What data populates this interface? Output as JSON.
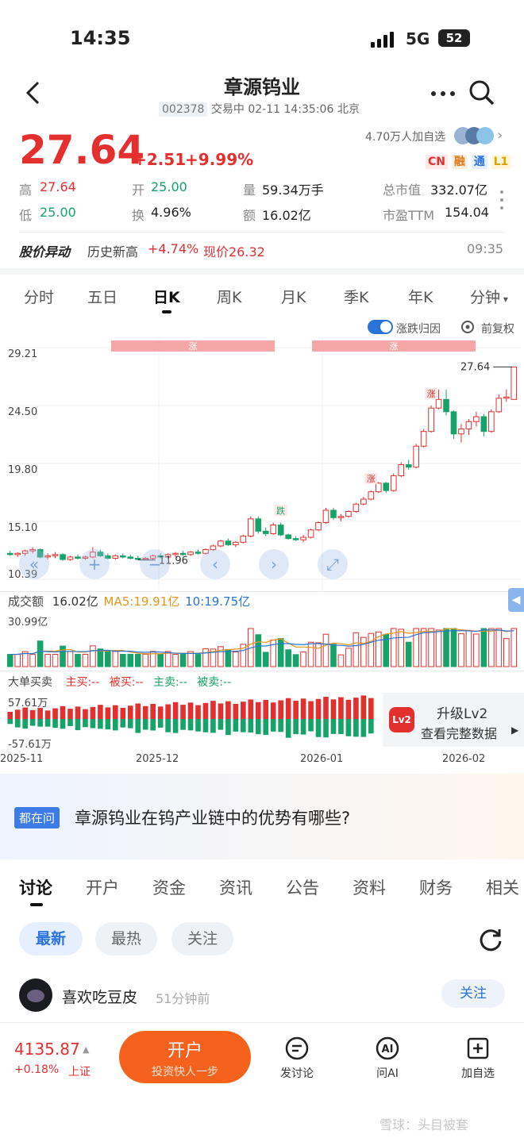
{
  "status_bar": {
    "time": "14:35",
    "network": "5G",
    "battery": "52"
  },
  "header": {
    "title": "章源钨业",
    "code": "002378",
    "trade_status": "交易中 02-11 14:35:06 北京"
  },
  "quote": {
    "price": "27.64",
    "change": "+2.51",
    "change_pct": "+9.99%",
    "followers": "4.70万人加自选",
    "badges": [
      "CN",
      "融",
      "通",
      "L1"
    ],
    "high_label": "高",
    "high": "27.64",
    "open_label": "开",
    "open": "25.00",
    "vol_label": "量",
    "vol": "59.34万手",
    "mcap_label": "总市值",
    "mcap": "332.07亿",
    "low_label": "低",
    "low": "25.00",
    "turn_label": "换",
    "turn": "4.96%",
    "amt_label": "额",
    "amt": "16.02亿",
    "pe_label": "市盈TTM",
    "pe": "154.04"
  },
  "alert": {
    "label": "股价异动",
    "text1": "历史新高",
    "text2": "+4.74%",
    "text3": "现价26.32",
    "time": "09:35"
  },
  "chart_tabs": [
    "分时",
    "五日",
    "日K",
    "周K",
    "月K",
    "季K",
    "年K",
    "分钟"
  ],
  "chart_tab_active": 2,
  "chart_options": {
    "toggle_label": "涨跌归因",
    "fq_label": "前复权"
  },
  "chart_data": {
    "type": "candlestick",
    "y_ticks": [
      "29.21",
      "24.50",
      "19.80",
      "15.10",
      "10.39"
    ],
    "ylim": [
      10.39,
      29.21
    ],
    "x_ticks": [
      "2025-11",
      "2025-12",
      "2026-01",
      "2026-02"
    ],
    "ohlc": [
      [
        12.5,
        12.7,
        12.3,
        12.4
      ],
      [
        12.4,
        12.6,
        12.2,
        12.5
      ],
      [
        12.5,
        12.8,
        12.3,
        12.7
      ],
      [
        12.7,
        13.0,
        12.5,
        12.8
      ],
      [
        12.8,
        12.9,
        12.1,
        12.2
      ],
      [
        12.2,
        12.5,
        12.0,
        12.3
      ],
      [
        12.3,
        12.6,
        12.1,
        12.4
      ],
      [
        12.4,
        12.5,
        11.9,
        12.0
      ],
      [
        12.0,
        12.3,
        11.9,
        12.2
      ],
      [
        12.2,
        12.4,
        12.0,
        12.1
      ],
      [
        12.1,
        12.3,
        11.96,
        12.2
      ],
      [
        12.2,
        13.0,
        12.1,
        12.6
      ],
      [
        12.6,
        12.8,
        12.2,
        12.3
      ],
      [
        12.3,
        12.5,
        12.0,
        12.1
      ],
      [
        12.1,
        12.4,
        12.0,
        12.3
      ],
      [
        12.3,
        12.5,
        12.1,
        12.2
      ],
      [
        12.2,
        12.4,
        12.0,
        12.1
      ],
      [
        12.1,
        12.3,
        11.96,
        12.0
      ],
      [
        12.0,
        12.2,
        11.96,
        12.1
      ],
      [
        12.1,
        12.4,
        12.0,
        12.3
      ],
      [
        12.3,
        12.5,
        12.1,
        12.2
      ],
      [
        12.2,
        12.5,
        12.1,
        12.4
      ],
      [
        12.4,
        12.6,
        12.2,
        12.5
      ],
      [
        12.5,
        12.7,
        12.3,
        12.4
      ],
      [
        12.4,
        12.7,
        12.3,
        12.6
      ],
      [
        12.6,
        12.8,
        12.4,
        12.5
      ],
      [
        12.5,
        12.9,
        12.4,
        12.8
      ],
      [
        12.8,
        13.2,
        12.7,
        13.1
      ],
      [
        13.1,
        13.6,
        13.0,
        13.5
      ],
      [
        13.5,
        13.7,
        13.1,
        13.2
      ],
      [
        13.2,
        13.5,
        13.0,
        13.4
      ],
      [
        13.4,
        14.0,
        13.3,
        13.9
      ],
      [
        13.9,
        15.5,
        13.8,
        15.3
      ],
      [
        15.3,
        15.5,
        14.1,
        14.3
      ],
      [
        14.3,
        14.6,
        13.9,
        14.1
      ],
      [
        14.1,
        15.0,
        14.0,
        14.8
      ],
      [
        14.8,
        15.0,
        13.9,
        14.0
      ],
      [
        14.0,
        14.1,
        13.6,
        13.7
      ],
      [
        13.7,
        13.9,
        13.5,
        13.6
      ],
      [
        13.6,
        14.0,
        13.4,
        13.8
      ],
      [
        13.8,
        14.5,
        13.7,
        14.4
      ],
      [
        14.4,
        15.1,
        14.3,
        15.0
      ],
      [
        15.0,
        16.2,
        14.9,
        16.0
      ],
      [
        16.0,
        16.2,
        15.2,
        15.4
      ],
      [
        15.4,
        15.7,
        15.1,
        15.5
      ],
      [
        15.5,
        16.0,
        15.4,
        15.9
      ],
      [
        15.9,
        16.6,
        15.8,
        16.5
      ],
      [
        16.5,
        17.1,
        16.4,
        16.9
      ],
      [
        16.9,
        17.6,
        16.8,
        17.5
      ],
      [
        17.5,
        18.3,
        17.4,
        18.2
      ],
      [
        18.2,
        18.3,
        17.4,
        17.6
      ],
      [
        17.6,
        19.0,
        17.5,
        18.8
      ],
      [
        18.8,
        19.9,
        18.7,
        19.7
      ],
      [
        19.7,
        20.1,
        19.3,
        19.5
      ],
      [
        19.5,
        21.4,
        19.4,
        21.2
      ],
      [
        21.2,
        22.6,
        21.1,
        22.4
      ],
      [
        22.4,
        24.5,
        22.3,
        24.3
      ],
      [
        24.3,
        25.8,
        24.2,
        25.0
      ],
      [
        25.0,
        25.8,
        23.7,
        24.0
      ],
      [
        24.0,
        24.1,
        21.8,
        22.2
      ],
      [
        22.2,
        23.0,
        21.5,
        22.6
      ],
      [
        22.6,
        23.4,
        22.1,
        23.2
      ],
      [
        23.2,
        24.0,
        22.8,
        23.6
      ],
      [
        23.6,
        23.8,
        22.0,
        22.4
      ],
      [
        22.4,
        24.2,
        22.3,
        24.0
      ],
      [
        24.0,
        25.4,
        23.9,
        25.1
      ],
      [
        25.1,
        25.8,
        24.8,
        25.2
      ],
      [
        25.0,
        27.64,
        25.0,
        27.64
      ]
    ],
    "high_label": "27.64",
    "low_label": "11.96",
    "markers": [
      {
        "text": "涨"
      },
      {
        "text": "涨"
      },
      {
        "text": "涨"
      },
      {
        "text": "跌"
      },
      {
        "text": "涨"
      },
      {
        "text": "涨"
      }
    ]
  },
  "volume": {
    "title": "成交额",
    "value": "16.02亿",
    "ma5": "MA5:19.91亿",
    "ma10": "10:19.75亿",
    "max": "30.99亿"
  },
  "bigorder": {
    "title": "大单买卖",
    "items": [
      "主买:--",
      "被买:--",
      "主卖:--",
      "被卖:--"
    ],
    "top": "57.61万",
    "bottom": "-57.61万",
    "upgrade": "升级Lv2",
    "detail": "查看完整数据",
    "lv_icon": "Lv2"
  },
  "ask": {
    "badge": "都在问",
    "question": "章源钨业在钨产业链中的优势有哪些?"
  },
  "discuss_tabs": [
    "讨论",
    "开户",
    "资金",
    "资讯",
    "公告",
    "资料",
    "财务",
    "相关"
  ],
  "filter_tabs": [
    "最新",
    "最热",
    "关注"
  ],
  "post": {
    "user": "喜欢吃豆皮",
    "time": "51分钟前",
    "follow": "关注"
  },
  "bottom": {
    "index": "4135.87",
    "index_chg": "+0.18%",
    "index_name": "上证",
    "open_btn": "开户",
    "open_sub": "投资快人一步",
    "actions": [
      {
        "icon": "comment-icon",
        "label": "发讨论"
      },
      {
        "icon": "ai-icon",
        "label": "问AI"
      },
      {
        "icon": "add-icon",
        "label": "加自选"
      }
    ]
  },
  "watermark": "雪球：头目被套"
}
